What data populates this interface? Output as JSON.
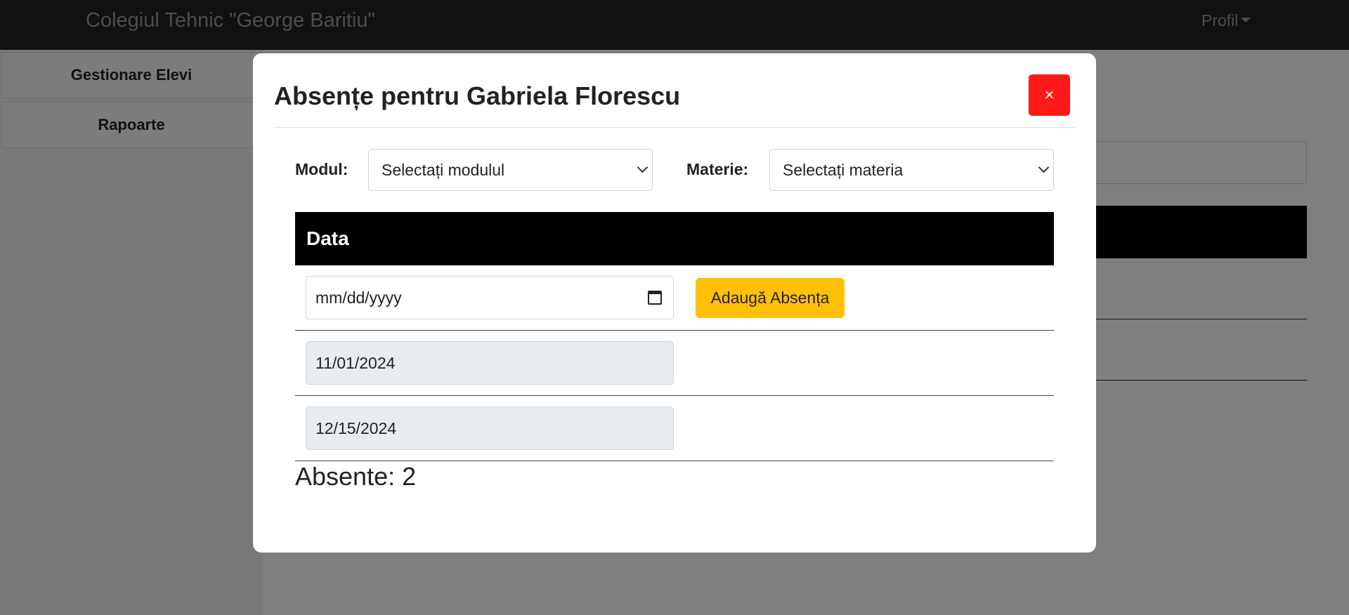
{
  "navbar": {
    "brand": "Colegiul Tehnic \"George Baritiu\"",
    "profile": "Profil"
  },
  "sidebar": {
    "items": [
      {
        "label": "Gestionare Elevi"
      },
      {
        "label": "Rapoarte"
      }
    ]
  },
  "modal": {
    "title": "Absențe pentru Gabriela Florescu",
    "close": "×",
    "filters": {
      "module_label": "Modul:",
      "module_value": "Selectați modulul",
      "subject_label": "Materie:",
      "subject_value": "Selectați materia"
    },
    "table": {
      "header": "Data",
      "new_date_placeholder": "mm/dd/yyyy",
      "add_button": "Adaugă Absența",
      "rows": [
        {
          "date": "11/01/2024"
        },
        {
          "date": "12/15/2024"
        }
      ]
    },
    "count_text": "Absente: 2"
  },
  "colors": {
    "accent": "#ffc107",
    "danger": "#ff1a1a",
    "navbar": "#222222"
  }
}
